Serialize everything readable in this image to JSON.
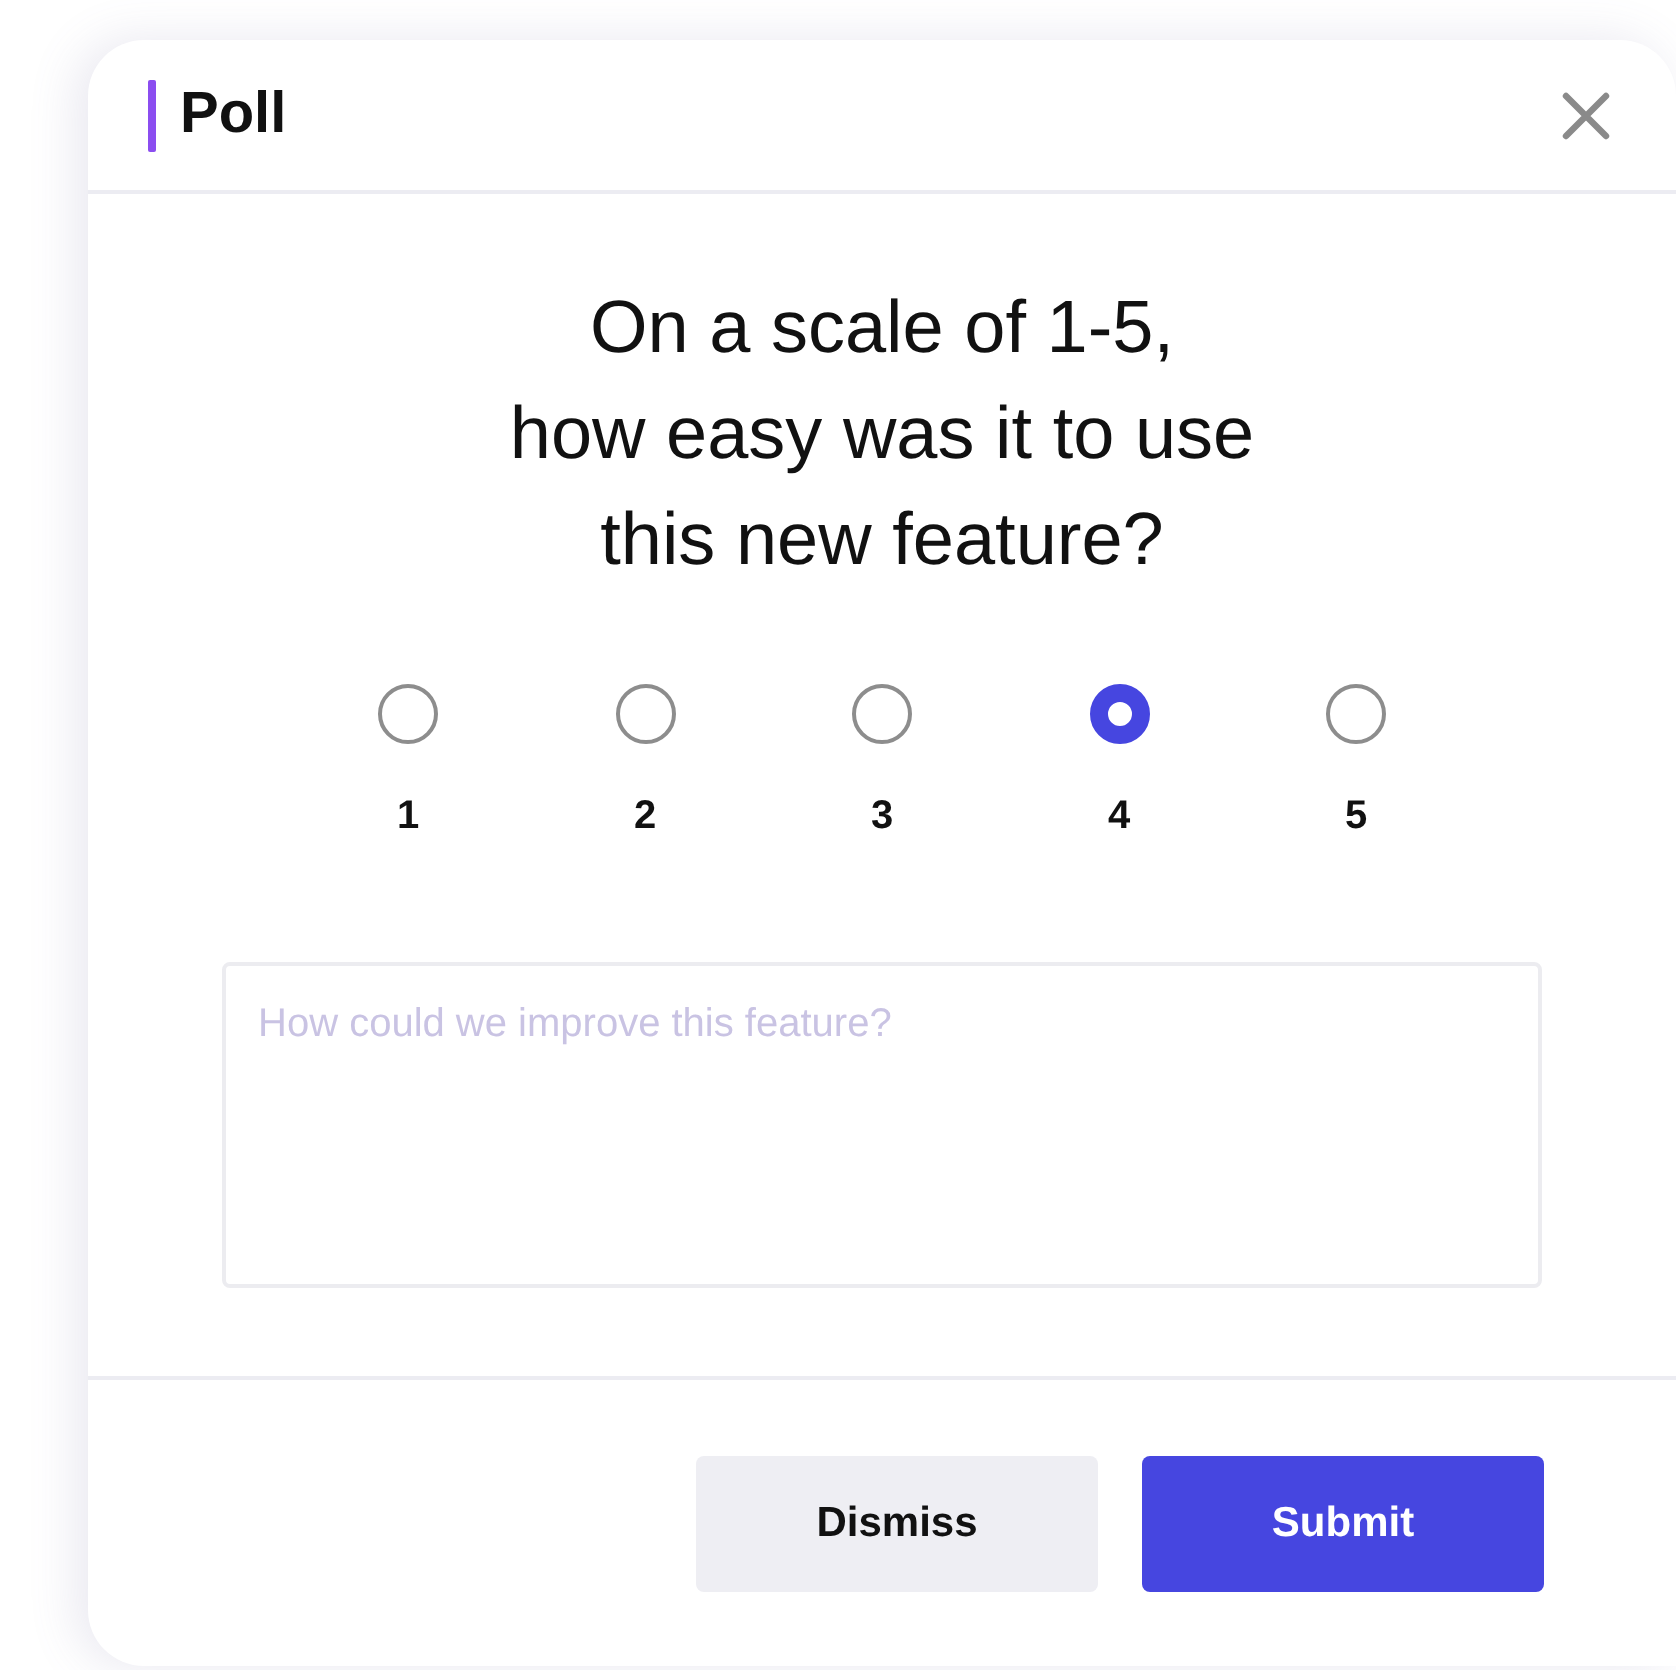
{
  "dialog": {
    "title": "Poll"
  },
  "question": [
    "On a scale of 1-5,",
    "how easy was it to use",
    "this new feature?"
  ],
  "options": [
    {
      "label": "1",
      "selected": false
    },
    {
      "label": "2",
      "selected": false
    },
    {
      "label": "3",
      "selected": false
    },
    {
      "label": "4",
      "selected": true
    },
    {
      "label": "5",
      "selected": false
    }
  ],
  "feedback": {
    "placeholder": "How could we improve this feature?"
  },
  "buttons": [
    {
      "label": "Dismiss",
      "kind": "secondary"
    },
    {
      "label": "Submit",
      "kind": "primary"
    }
  ]
}
